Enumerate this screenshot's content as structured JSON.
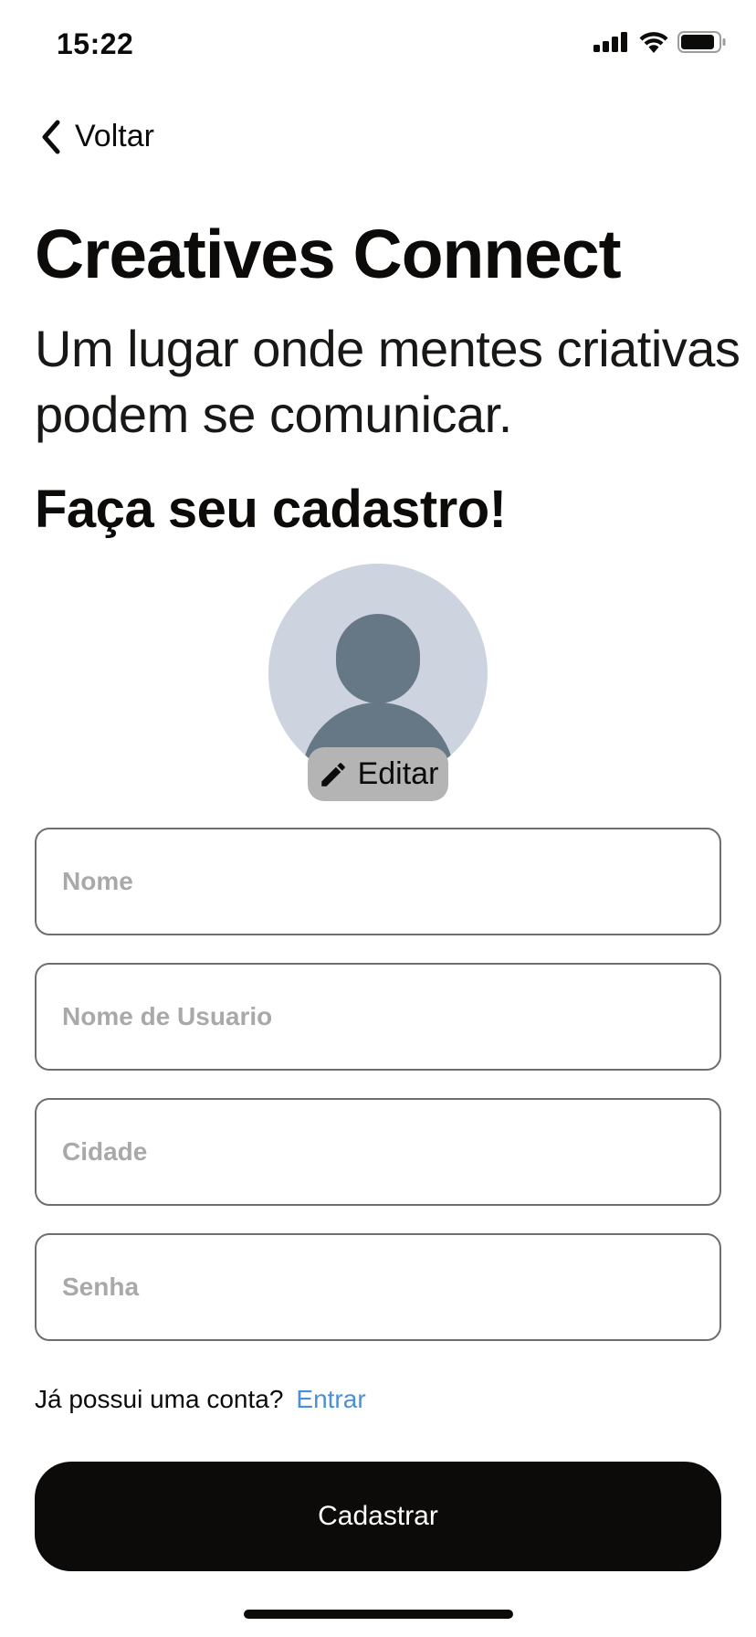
{
  "status_bar": {
    "time": "15:22",
    "icons": [
      "signal-icon",
      "wifi-icon",
      "battery-icon"
    ]
  },
  "nav": {
    "back_label": "Voltar",
    "back_icon": "chevron-left-icon"
  },
  "header": {
    "title": "Creatives Connect",
    "subtitle": "Um lugar onde mentes criativas podem se comunicar."
  },
  "form": {
    "heading": "Faça seu cadastro!",
    "avatar": {
      "edit_label": "Editar",
      "edit_icon": "pencil-icon"
    },
    "fields": {
      "name": {
        "placeholder": "Nome",
        "value": ""
      },
      "username": {
        "placeholder": "Nome de Usuario",
        "value": ""
      },
      "city": {
        "placeholder": "Cidade",
        "value": ""
      },
      "password": {
        "placeholder": "Senha",
        "value": ""
      }
    },
    "login_prompt": "Já possui uma conta?",
    "login_link": "Entrar",
    "submit_label": "Cadastrar"
  },
  "colors": {
    "text": "#0d0b09",
    "link": "#4a90d9",
    "avatar_bg": "#cdd3df",
    "avatar_figure": "#667785",
    "edit_button_bg": "#b4b4b4",
    "field_border": "#6e6e6e",
    "placeholder": "#a9a9a9",
    "button_bg": "#0d0b09",
    "button_text": "#ffffff"
  }
}
